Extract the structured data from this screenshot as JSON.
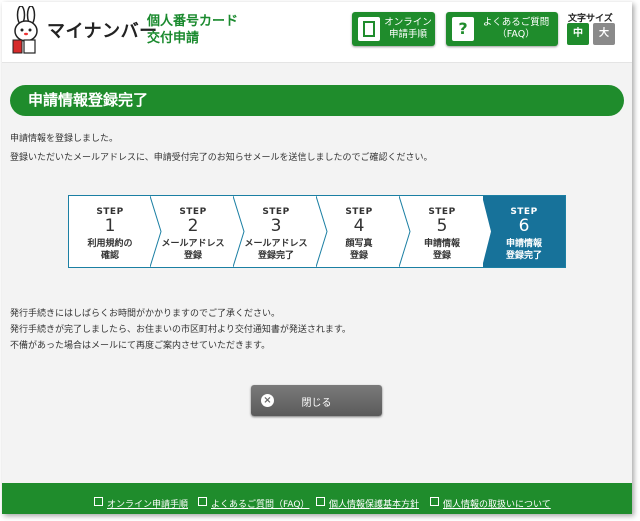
{
  "header": {
    "logo_text": "マイナンバー",
    "service_title_line1": "個人番号カード",
    "service_title_line2": "交付申請",
    "btn_online": {
      "line1": "オンライン",
      "line2": "申請手順",
      "icon": "book-icon"
    },
    "btn_faq": {
      "line1": "よくあるご質問",
      "line2": "（FAQ）",
      "icon": "question-icon"
    },
    "font_size_label": "文字サイズ",
    "font_size_medium": "中",
    "font_size_large": "大",
    "colors": {
      "brand_green": "#1f8c2c",
      "active_step": "#17729a"
    }
  },
  "main": {
    "page_title": "申請情報登録完了",
    "message1": "申請情報を登録しました。",
    "message2": "登録いただいたメールアドレスに、申請受付完了のお知らせメールを送信しましたのでご確認ください。",
    "steps": [
      {
        "label": "STEP",
        "number": "1",
        "name1": "利用規約の",
        "name2": "確認"
      },
      {
        "label": "STEP",
        "number": "2",
        "name1": "メールアドレス",
        "name2": "登録"
      },
      {
        "label": "STEP",
        "number": "3",
        "name1": "メールアドレス",
        "name2": "登録完了"
      },
      {
        "label": "STEP",
        "number": "4",
        "name1": "顔写真",
        "name2": "登録"
      },
      {
        "label": "STEP",
        "number": "5",
        "name1": "申請情報",
        "name2": "登録"
      },
      {
        "label": "STEP",
        "number": "6",
        "name1": "申請情報",
        "name2": "登録完了"
      }
    ],
    "active_step": 6,
    "notice1": "発行手続きにはしばらくお時間がかかりますのでご了承ください。",
    "notice2": "発行手続きが完了しましたら、お住まいの市区町村より交付通知書が発送されます。",
    "notice3": "不備があった場合はメールにて再度ご案内させていただきます。",
    "close_label": "閉じる"
  },
  "footer": {
    "links": [
      "オンライン申請手順",
      "よくあるご質問（FAQ）",
      "個人情報保護基本方針",
      "個人情報の取扱いについて"
    ]
  }
}
